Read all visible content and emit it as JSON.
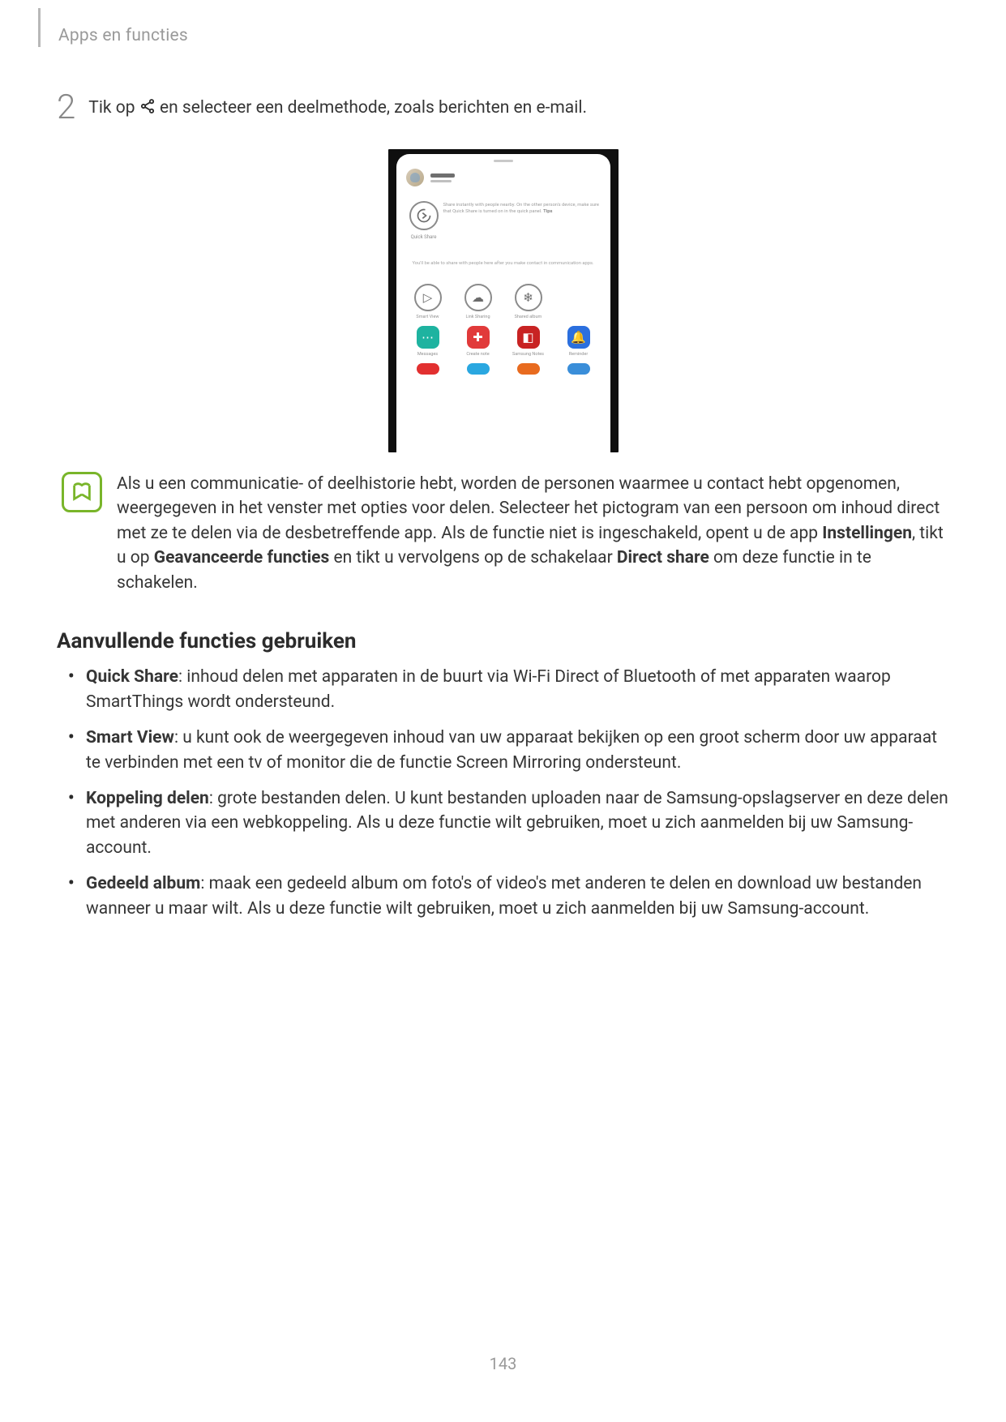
{
  "header": {
    "section": "Apps en functies"
  },
  "step": {
    "number": "2",
    "before": "Tik op ",
    "after": " en selecteer een deelmethode, zoals berichten en e-mail."
  },
  "shot": {
    "quick_share_label": "Quick Share",
    "quick_share_desc_pre": "Share instantly with people nearby. On the other person's device, make sure that Quick Share is turned on in the quick panel. ",
    "quick_share_desc_bold": "Tips",
    "info_line": "You'll be able to share with people here after you make contact in communication apps.",
    "row1": [
      {
        "label": "Smart View",
        "glyph": "▷",
        "kind": "outline"
      },
      {
        "label": "Link Sharing",
        "glyph": "☁",
        "kind": "outline"
      },
      {
        "label": "Shared album",
        "glyph": "❄",
        "kind": "outline"
      }
    ],
    "row2": [
      {
        "label": "Messages",
        "glyph": "⋯",
        "bg": "ic-teal"
      },
      {
        "label": "Create note",
        "glyph": "✚",
        "bg": "ic-red"
      },
      {
        "label": "Samsung Notes",
        "glyph": "◧",
        "bg": "ic-darkred"
      },
      {
        "label": "Reminder",
        "glyph": "🔔",
        "bg": "ic-blue"
      }
    ],
    "row3": [
      {
        "bg": "ic-red2"
      },
      {
        "bg": "ic-cyan"
      },
      {
        "bg": "ic-orange"
      },
      {
        "bg": "ic-skyblue"
      }
    ]
  },
  "note": {
    "text_parts": [
      "Als u een communicatie- of deelhistorie hebt, worden de personen waarmee u contact hebt opgenomen, weergegeven in het venster met opties voor delen. Selecteer het pictogram van een persoon om inhoud direct met ze te delen via de desbetreffende app. Als de functie niet is ingeschakeld, opent u de app ",
      "Instellingen",
      ", tikt u op ",
      "Geavanceerde functies",
      " en tikt u vervolgens op de schakelaar ",
      "Direct share",
      " om deze functie in te schakelen."
    ]
  },
  "subheading": "Aanvullende functies gebruiken",
  "bullets": [
    {
      "label": "Quick Share",
      "text": ": inhoud delen met apparaten in de buurt via Wi-Fi Direct of Bluetooth of met apparaten waarop SmartThings wordt ondersteund."
    },
    {
      "label": "Smart View",
      "text": ": u kunt ook de weergegeven inhoud van uw apparaat bekijken op een groot scherm door uw apparaat te verbinden met een tv of monitor die de functie Screen Mirroring ondersteunt."
    },
    {
      "label": "Koppeling delen",
      "text": ": grote bestanden delen. U kunt bestanden uploaden naar de Samsung-opslagserver en deze delen met anderen via een webkoppeling. Als u deze functie wilt gebruiken, moet u zich aanmelden bij uw Samsung-account."
    },
    {
      "label": "Gedeeld album",
      "text": ": maak een gedeeld album om foto's of video's met anderen te delen en download uw bestanden wanneer u maar wilt. Als u deze functie wilt gebruiken, moet u zich aanmelden bij uw Samsung-account."
    }
  ],
  "page_number": "143"
}
